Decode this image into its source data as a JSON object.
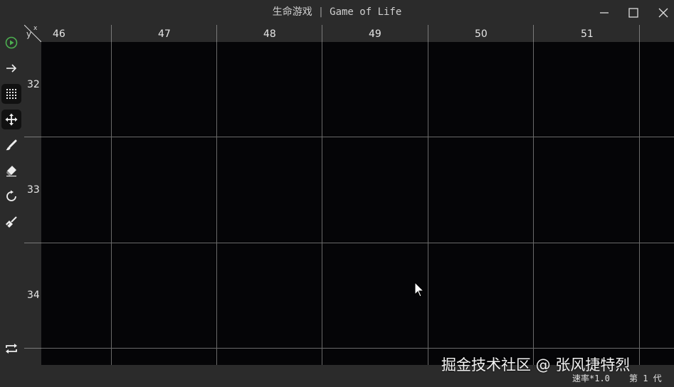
{
  "window": {
    "title_cn": "生命游戏",
    "title_separator": "|",
    "title_en": "Game of Life"
  },
  "toolbar": {
    "tools": [
      {
        "icon": "play-icon",
        "active": false,
        "accent": "#4caf50"
      },
      {
        "icon": "step-forward-arrow-icon",
        "active": false
      },
      {
        "icon": "grid-toggle-icon",
        "active": true
      },
      {
        "icon": "move-icon",
        "active": true
      },
      {
        "icon": "brush-icon",
        "active": false
      },
      {
        "icon": "eraser-icon",
        "active": false
      },
      {
        "icon": "reset-icon",
        "active": false
      },
      {
        "icon": "clean-broom-icon",
        "active": false
      }
    ],
    "bottom_tool": {
      "icon": "switch-icon"
    }
  },
  "ruler": {
    "corner_y": "y",
    "corner_x": "x",
    "x_ticks": [
      "46",
      "47",
      "48",
      "49",
      "50",
      "51"
    ],
    "y_ticks": [
      "32",
      "33",
      "34"
    ]
  },
  "status": {
    "speed": "速率*1.0",
    "generation": "第 1 代"
  },
  "watermark": "掘金技术社区 @ 张风捷特烈",
  "colors": {
    "background": "#2b2b2b",
    "canvas": "#050507",
    "grid_line": "#6a6a6a",
    "play_accent": "#4caf50"
  }
}
